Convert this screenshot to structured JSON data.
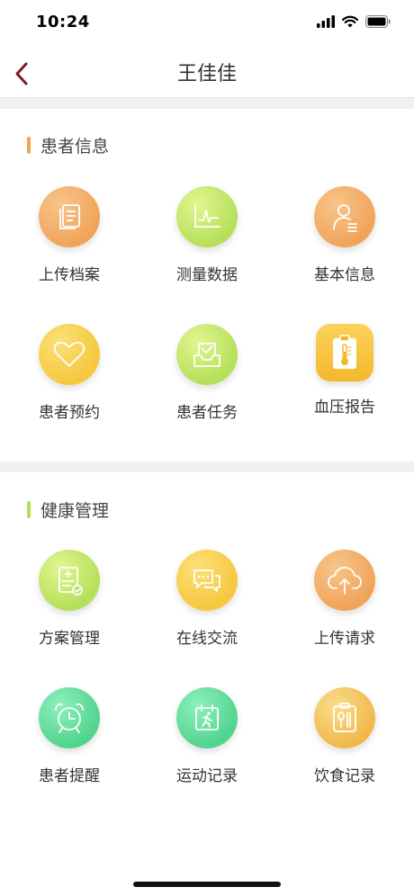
{
  "status": {
    "time": "10:24"
  },
  "header": {
    "title": "王佳佳"
  },
  "colors": {
    "accent_orange": "#f0a45a",
    "accent_lime": "#b5e05a",
    "back": "#7a1f1f"
  },
  "sections": [
    {
      "title": "患者信息",
      "items": [
        {
          "label": "上传档案",
          "icon": "documents-icon"
        },
        {
          "label": "测量数据",
          "icon": "chart-line-icon"
        },
        {
          "label": "基本信息",
          "icon": "user-info-icon"
        },
        {
          "label": "患者预约",
          "icon": "heart-icon"
        },
        {
          "label": "患者任务",
          "icon": "inbox-check-icon"
        },
        {
          "label": "血压报告",
          "icon": "thermometer-clipboard-icon"
        }
      ]
    },
    {
      "title": "健康管理",
      "items": [
        {
          "label": "方案管理",
          "icon": "plan-document-icon"
        },
        {
          "label": "在线交流",
          "icon": "chat-bubbles-icon"
        },
        {
          "label": "上传请求",
          "icon": "cloud-upload-icon"
        },
        {
          "label": "患者提醒",
          "icon": "alarm-clock-icon"
        },
        {
          "label": "运动记录",
          "icon": "running-calendar-icon"
        },
        {
          "label": "饮食记录",
          "icon": "food-clipboard-icon"
        }
      ]
    }
  ]
}
